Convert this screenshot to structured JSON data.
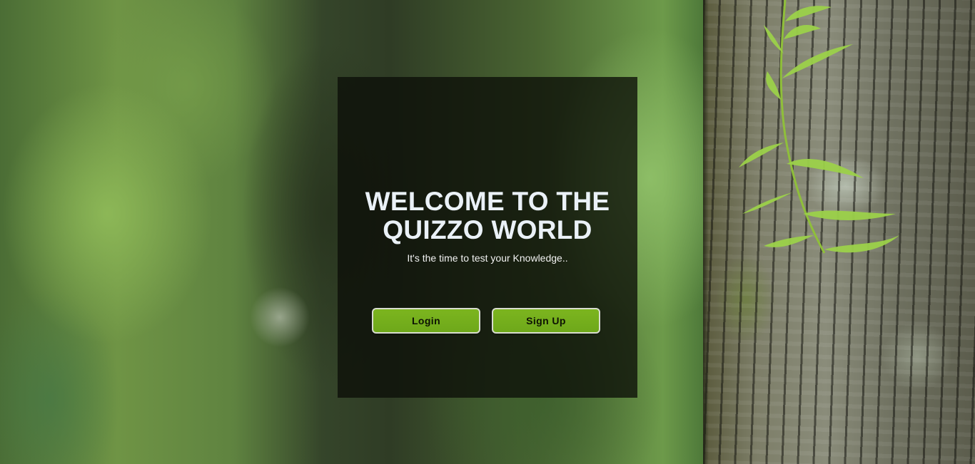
{
  "page": {
    "heading_line1": "WELCOME TO THE",
    "heading_line2": "QUIZZO WORLD",
    "subtitle": "It's the time to test your Knowledge..",
    "login_label": "Login",
    "signup_label": "Sign Up"
  },
  "colors": {
    "button_green": "#76b01d",
    "heading_text": "#eaf1f7",
    "card_overlay": "rgba(12,14,8,0.78)"
  },
  "background": {
    "description_icon": "forest-tree-background"
  }
}
